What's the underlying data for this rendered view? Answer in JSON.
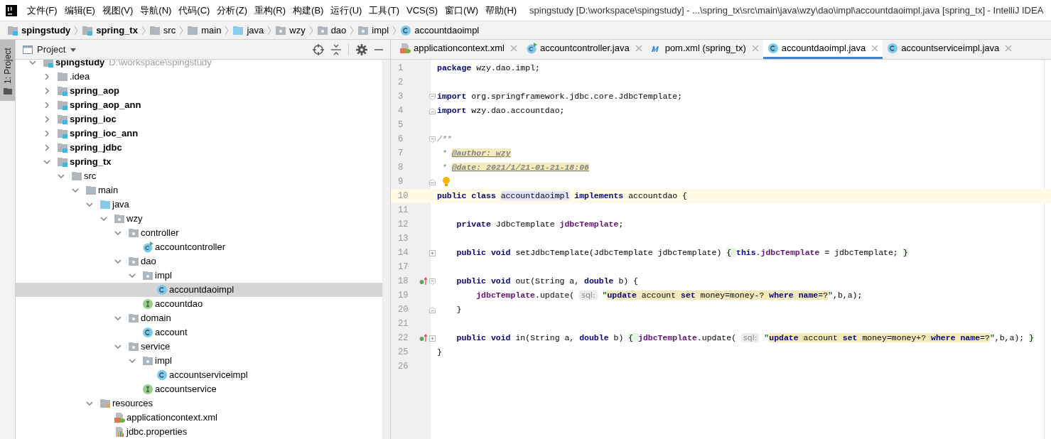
{
  "window": {
    "title": "spingstudy [D:\\workspace\\spingstudy] - ...\\spring_tx\\src\\main\\java\\wzy\\dao\\impl\\accountdaoimpl.java [spring_tx] - IntelliJ IDEA"
  },
  "menu": [
    "文件(F)",
    "编辑(E)",
    "视图(V)",
    "导航(N)",
    "代码(C)",
    "分析(Z)",
    "重构(R)",
    "构建(B)",
    "运行(U)",
    "工具(T)",
    "VCS(S)",
    "窗口(W)",
    "帮助(H)"
  ],
  "breadcrumbs": [
    {
      "label": "spingstudy",
      "kind": "module"
    },
    {
      "label": "spring_tx",
      "kind": "module"
    },
    {
      "label": "src",
      "kind": "folder"
    },
    {
      "label": "main",
      "kind": "folder"
    },
    {
      "label": "java",
      "kind": "source"
    },
    {
      "label": "wzy",
      "kind": "package"
    },
    {
      "label": "dao",
      "kind": "package"
    },
    {
      "label": "impl",
      "kind": "package"
    },
    {
      "label": "accountdaoimpl",
      "kind": "class"
    }
  ],
  "tool_strip": {
    "label": "1: Project",
    "selected": true
  },
  "project_panel": {
    "title": "Project",
    "tree": [
      {
        "label": "spingstudy",
        "path": "D:\\workspace\\spingstudy",
        "kind": "module",
        "expanded": true,
        "selected": false,
        "children": [
          {
            "label": ".idea",
            "kind": "folder",
            "expanded": false,
            "selected": false
          },
          {
            "label": "spring_aop",
            "kind": "module",
            "expanded": false,
            "selected": false
          },
          {
            "label": "spring_aop_ann",
            "kind": "module",
            "expanded": false,
            "selected": false
          },
          {
            "label": "spring_ioc",
            "kind": "module",
            "expanded": false,
            "selected": false
          },
          {
            "label": "spring_ioc_ann",
            "kind": "module",
            "expanded": false,
            "selected": false
          },
          {
            "label": "spring_jdbc",
            "kind": "module",
            "expanded": false,
            "selected": false
          },
          {
            "label": "spring_tx",
            "kind": "module",
            "expanded": true,
            "selected": false,
            "children": [
              {
                "label": "src",
                "kind": "folder",
                "expanded": true,
                "selected": false,
                "children": [
                  {
                    "label": "main",
                    "kind": "folder",
                    "expanded": true,
                    "selected": false,
                    "children": [
                      {
                        "label": "java",
                        "kind": "source",
                        "expanded": true,
                        "selected": false,
                        "children": [
                          {
                            "label": "wzy",
                            "kind": "package",
                            "expanded": true,
                            "selected": false,
                            "children": [
                              {
                                "label": "controller",
                                "kind": "package",
                                "expanded": true,
                                "selected": false,
                                "children": [
                                  {
                                    "label": "accountcontroller",
                                    "kind": "runnable",
                                    "selected": false
                                  }
                                ]
                              },
                              {
                                "label": "dao",
                                "kind": "package",
                                "expanded": true,
                                "selected": false,
                                "children": [
                                  {
                                    "label": "impl",
                                    "kind": "package",
                                    "expanded": true,
                                    "selected": false,
                                    "children": [
                                      {
                                        "label": "accountdaoimpl",
                                        "kind": "class",
                                        "selected": true
                                      }
                                    ]
                                  },
                                  {
                                    "label": "accountdao",
                                    "kind": "interface",
                                    "selected": false
                                  }
                                ]
                              },
                              {
                                "label": "domain",
                                "kind": "package",
                                "expanded": true,
                                "selected": false,
                                "children": [
                                  {
                                    "label": "account",
                                    "kind": "class",
                                    "selected": false
                                  }
                                ]
                              },
                              {
                                "label": "service",
                                "kind": "package",
                                "expanded": true,
                                "selected": false,
                                "children": [
                                  {
                                    "label": "impl",
                                    "kind": "package",
                                    "expanded": true,
                                    "selected": false,
                                    "children": [
                                      {
                                        "label": "accountserviceimpl",
                                        "kind": "class",
                                        "selected": false
                                      }
                                    ]
                                  },
                                  {
                                    "label": "accountservice",
                                    "kind": "interface",
                                    "selected": false
                                  }
                                ]
                              }
                            ]
                          }
                        ]
                      },
                      {
                        "label": "resources",
                        "kind": "resources",
                        "expanded": true,
                        "selected": false,
                        "children": [
                          {
                            "label": "applicationcontext.xml",
                            "kind": "xml",
                            "selected": false
                          },
                          {
                            "label": "jdbc.properties",
                            "kind": "properties",
                            "selected": false
                          }
                        ]
                      }
                    ]
                  }
                ]
              }
            ]
          }
        ]
      }
    ]
  },
  "editor_tabs": [
    {
      "label": "applicationcontext.xml",
      "kind": "xml",
      "selected": false
    },
    {
      "label": "accountcontroller.java",
      "kind": "runnable",
      "selected": false
    },
    {
      "label": "pom.xml (spring_tx)",
      "kind": "maven",
      "selected": false
    },
    {
      "label": "accountdaoimpl.java",
      "kind": "class",
      "selected": true
    },
    {
      "label": "accountserviceimpl.java",
      "kind": "class",
      "selected": false
    }
  ],
  "code": [
    {
      "number": "1",
      "kind": "line",
      "tokens": [
        {
          "kind": "kw",
          "text": "package"
        },
        {
          "kind": "plain",
          "text": " wzy.dao.impl;"
        }
      ]
    },
    {
      "number": "2",
      "kind": "line"
    },
    {
      "number": "3",
      "kind": "opener",
      "tokens": [
        {
          "kind": "kw",
          "text": "import"
        },
        {
          "kind": "plain",
          "text": " org.springframework.jdbc.core.JdbcTemplate;"
        }
      ]
    },
    {
      "number": "4",
      "kind": "closer",
      "tokens": [
        {
          "kind": "kw",
          "text": "import"
        },
        {
          "kind": "plain",
          "text": " wzy.dao.accountdao;"
        }
      ]
    },
    {
      "number": "5",
      "kind": "line"
    },
    {
      "number": "6",
      "kind": "opener",
      "tokens": [
        {
          "kind": "comment",
          "text": "/**"
        }
      ]
    },
    {
      "number": "7",
      "kind": "line",
      "tokens": [
        {
          "kind": "comment",
          "text": " * "
        },
        {
          "kind": "doctag",
          "text": "@author: wzy"
        }
      ]
    },
    {
      "number": "8",
      "kind": "line",
      "tokens": [
        {
          "kind": "comment",
          "text": " * "
        },
        {
          "kind": "doctag",
          "text": "@date: 2021/1/21-01-21-18:06"
        }
      ]
    },
    {
      "number": "9",
      "kind": "closer",
      "bulb": true
    },
    {
      "number": "10",
      "kind": "line",
      "current": true,
      "tokens": [
        {
          "kind": "kw",
          "text": "public class "
        },
        {
          "kind": "decl",
          "text": "accountdaoimpl"
        },
        {
          "kind": "kw",
          "text": " implements"
        },
        {
          "kind": "plain",
          "text": " accountdao {"
        }
      ]
    },
    {
      "number": "11",
      "kind": "line"
    },
    {
      "number": "12",
      "kind": "line",
      "tokens": [
        {
          "kind": "kw",
          "text": "    private"
        },
        {
          "kind": "plain",
          "text": " JdbcTemplate "
        },
        {
          "kind": "field",
          "text": "jdbcTemplate"
        },
        {
          "kind": "plain",
          "text": ";"
        }
      ]
    },
    {
      "number": "13",
      "kind": "line"
    },
    {
      "number": "14",
      "kind": "folded",
      "tokens": [
        {
          "kind": "kw",
          "text": "    public void"
        },
        {
          "kind": "plain",
          "text": " setJdbcTemplate(JdbcTemplate jdbcTemplate) "
        },
        {
          "kind": "brace",
          "text": "{ "
        },
        {
          "kind": "kw",
          "text": "this"
        },
        {
          "kind": "plain",
          "text": "."
        },
        {
          "kind": "field",
          "text": "jdbcTemplate"
        },
        {
          "kind": "plain",
          "text": " = jdbcTemplate; "
        },
        {
          "kind": "brace",
          "text": "}"
        }
      ]
    },
    {
      "number": "17",
      "kind": "line"
    },
    {
      "number": "18",
      "kind": "opener",
      "marker": true,
      "tokens": [
        {
          "kind": "kw",
          "text": "    public void"
        },
        {
          "kind": "plain",
          "text": " out(String a, "
        },
        {
          "kind": "kw",
          "text": "double"
        },
        {
          "kind": "plain",
          "text": " b) {"
        }
      ]
    },
    {
      "number": "19",
      "kind": "line",
      "tokens": [
        {
          "kind": "field",
          "text": "        jdbcTemplate"
        },
        {
          "kind": "plain",
          "text": ".update( "
        },
        {
          "kind": "hint",
          "text": "sql:"
        },
        {
          "kind": "quote",
          "text": " \""
        },
        {
          "kind": "sqlkw",
          "text": "update"
        },
        {
          "kind": "sql",
          "text": " account "
        },
        {
          "kind": "sqlkw",
          "text": "set"
        },
        {
          "kind": "sql",
          "text": " money=money-? "
        },
        {
          "kind": "sqlkw",
          "text": "where name"
        },
        {
          "kind": "sql",
          "text": "=?"
        },
        {
          "kind": "quote",
          "text": "\""
        },
        {
          "kind": "plain",
          "text": ",b,a);"
        }
      ]
    },
    {
      "number": "20",
      "kind": "closer",
      "tokens": [
        {
          "kind": "plain",
          "text": "    }"
        }
      ]
    },
    {
      "number": "21",
      "kind": "line"
    },
    {
      "number": "22",
      "kind": "folded",
      "marker": true,
      "tokens": [
        {
          "kind": "kw",
          "text": "    public void"
        },
        {
          "kind": "plain",
          "text": " in(String a, "
        },
        {
          "kind": "kw",
          "text": "double"
        },
        {
          "kind": "plain",
          "text": " b) "
        },
        {
          "kind": "brace",
          "text": "{ "
        },
        {
          "kind": "field",
          "text": "jdbcTemplate"
        },
        {
          "kind": "plain",
          "text": ".update( "
        },
        {
          "kind": "hint",
          "text": "sql:"
        },
        {
          "kind": "quote",
          "text": " \""
        },
        {
          "kind": "sqlkw",
          "text": "update"
        },
        {
          "kind": "sql",
          "text": " account "
        },
        {
          "kind": "sqlkw",
          "text": "set"
        },
        {
          "kind": "sql",
          "text": " money=money+? "
        },
        {
          "kind": "sqlkw",
          "text": "where name"
        },
        {
          "kind": "sql",
          "text": "=?"
        },
        {
          "kind": "quote",
          "text": "\""
        },
        {
          "kind": "plain",
          "text": ",b,a); "
        },
        {
          "kind": "brace",
          "text": "}"
        }
      ]
    },
    {
      "number": "25",
      "kind": "line",
      "tokens": [
        {
          "kind": "plain",
          "text": "}"
        }
      ]
    },
    {
      "number": "26",
      "kind": "line"
    }
  ]
}
